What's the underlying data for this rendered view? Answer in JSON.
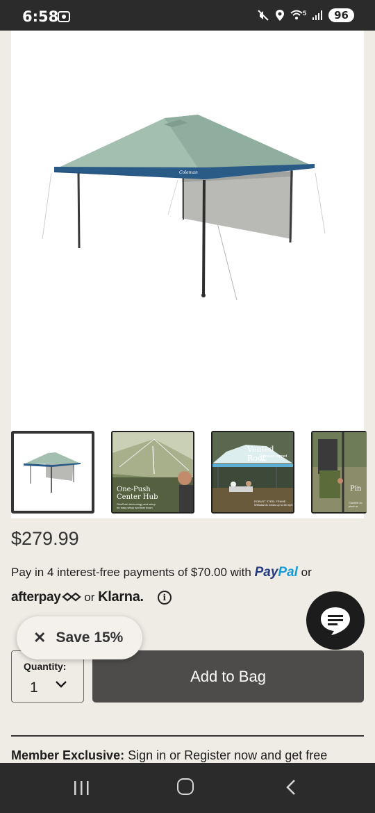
{
  "status_bar": {
    "time": "6:58",
    "network": "5",
    "battery": "96"
  },
  "product": {
    "hero_image_icon": "canopy-tent-image",
    "brand_on_canopy": "Coleman",
    "thumbnails": [
      {
        "icon": "canopy-tent-thumbnail",
        "selected": true
      },
      {
        "icon": "center-hub-thumbnail",
        "caption": "One-Push Center Hub",
        "subcaption": "OnePush technology and setup for easy setup and tear down"
      },
      {
        "icon": "vented-roof-thumbnail",
        "heading": "Vented Roof",
        "sub": "Releases trapped heat",
        "foot_title": "ROBUST STEEL FRAME",
        "foot_text": "Withstands winds up to 35 mph"
      },
      {
        "icon": "pin-thumbnail",
        "caption": "Pin",
        "subcaption": "Comfort Gr pinch-a"
      }
    ],
    "price": "$279.99"
  },
  "payment": {
    "text_before": "Pay in 4 interest-free payments of $70.00 with ",
    "paypal_part1": "Pay",
    "paypal_part2": "Pal",
    "text_after": " or",
    "afterpay": "afterpay",
    "or": " or ",
    "klarna": "Klarna.",
    "info_icon": "info-icon"
  },
  "save_chip": {
    "icon": "close-icon",
    "label": "Save 15%"
  },
  "quantity": {
    "label": "Quantity:",
    "value": "1"
  },
  "add_to_bag": {
    "label": "Add to Bag"
  },
  "member": {
    "bold": "Member Exclusive:",
    "text": " Sign in or Register now and get free"
  },
  "colors": {
    "canopy_light": "#a3bfb0",
    "canopy_dark": "#2a5b87",
    "add_bag": "#4e4c4a",
    "paypal_dark": "#253b80",
    "paypal_light": "#179bd7",
    "background": "#efebe5"
  }
}
